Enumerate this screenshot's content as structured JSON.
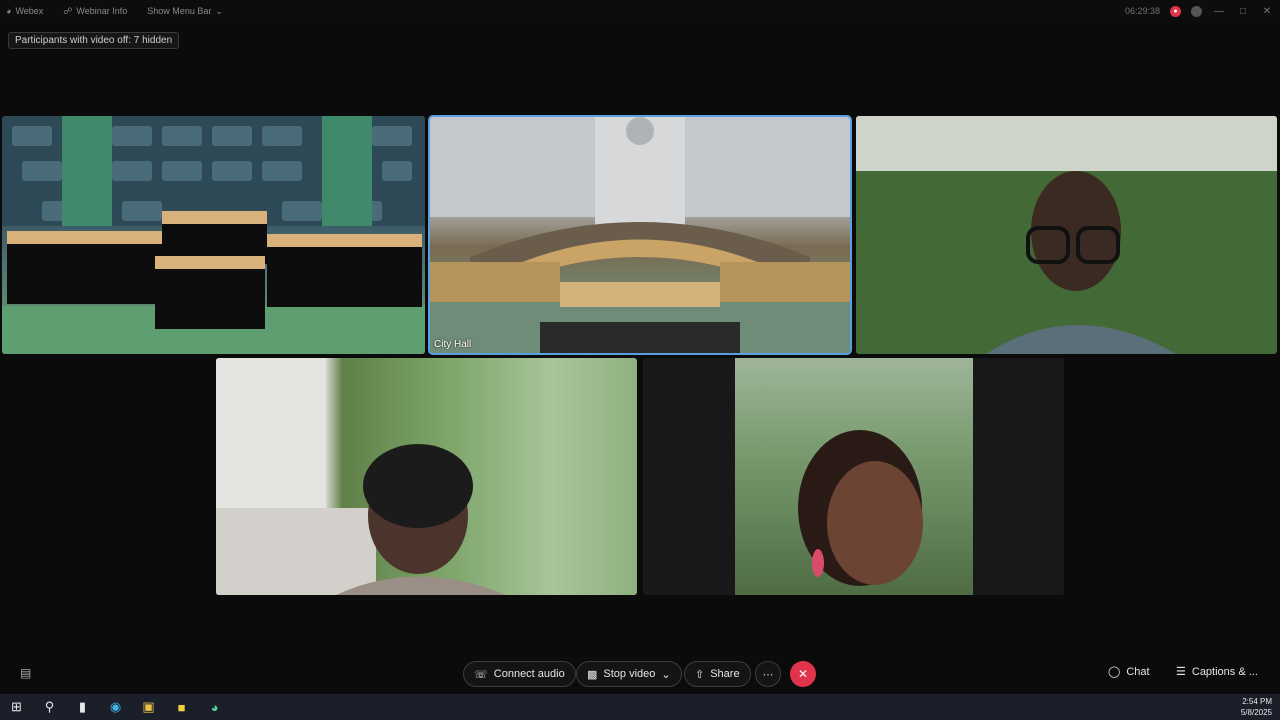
{
  "titlebar": {
    "app_name": "Webex",
    "webinar_info": "Webinar Info",
    "show_menu_bar": "Show Menu Bar",
    "timer": "06:29:38"
  },
  "hidden_participants": "Participants with video off: 7 hidden",
  "tiles": [
    {
      "label": ""
    },
    {
      "label": "City Hall"
    },
    {
      "label": ""
    },
    {
      "label": ""
    },
    {
      "label": ""
    }
  ],
  "controls": {
    "connect_audio": "Connect audio",
    "stop_video": "Stop video",
    "share": "Share",
    "chat": "Chat",
    "captions": "Captions & ..."
  },
  "taskbar": {
    "time": "2:54 PM",
    "date": "5/8/2025"
  },
  "colors": {
    "end_call": "#e0344a",
    "active_border": "#5aa0e0"
  }
}
